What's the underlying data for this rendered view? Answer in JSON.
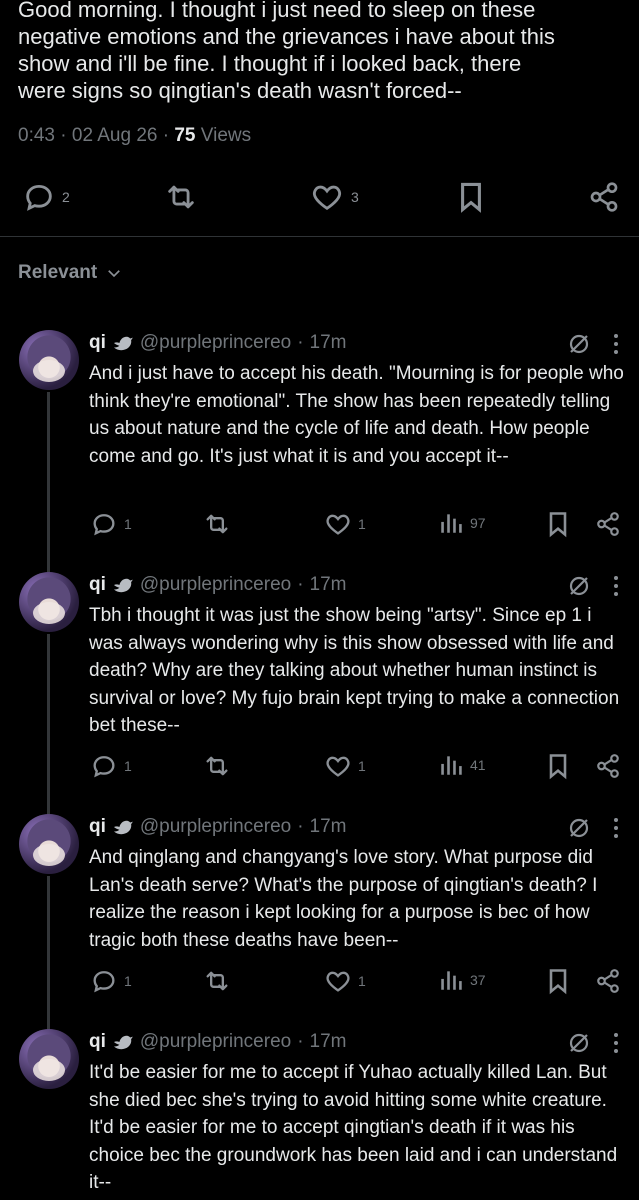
{
  "main_post": {
    "text": "Good morning. I thought i just need to sleep on these\nnegative emotions and the grievances i have about this\nshow and i'll be fine. I thought if i looked back, there\nwere signs so qingtian's death wasn't forced--",
    "time": "0:43",
    "date": "02 Aug 26",
    "views_count": "75",
    "views_label": "Views",
    "replies": "2",
    "likes": "3"
  },
  "sort": {
    "label": "Relevant"
  },
  "replies": [
    {
      "name": "qi",
      "handle": "@purpleprincereo",
      "time": "17m",
      "text": "And i just have to accept his death. \"Mourning is for people who think they're emotional\". The show has been repeatedly telling us about nature and the cycle of life and death. How people come and go. It's just what it is and you accept it--",
      "replies": "1",
      "likes": "1",
      "views": "97"
    },
    {
      "name": "qi",
      "handle": "@purpleprincereo",
      "time": "17m",
      "text": "Tbh i thought it was just the show being \"artsy\". Since ep 1 i was always wondering why is this show obsessed with life and death? Why are they talking about whether human instinct is survival or love? My fujo brain kept trying to make a connection bet these--",
      "replies": "1",
      "likes": "1",
      "views": "41"
    },
    {
      "name": "qi",
      "handle": "@purpleprincereo",
      "time": "17m",
      "text": "And qinglang and changyang's love story. What purpose did Lan's death serve? What's the purpose of qingtian's death? I realize the reason i kept looking for a purpose is bec of how tragic both these deaths have been--",
      "replies": "1",
      "likes": "1",
      "views": "37"
    },
    {
      "name": "qi",
      "handle": "@purpleprincereo",
      "time": "17m",
      "text": "It'd be easier for me to accept if Yuhao actually killed Lan. But she died bec she's trying to avoid hitting some white creature. It'd be easier for me to accept qingtian's death if it was his choice bec the groundwork has been laid and i can understand it--"
    }
  ],
  "icons": {
    "reply": "reply-icon",
    "repost": "repost-icon",
    "like": "like-icon",
    "bookmark": "bookmark-icon",
    "share": "share-icon",
    "views": "views-icon",
    "grok": "grok-icon",
    "more": "more-icon",
    "verified": "bird-badge-icon"
  },
  "colors": {
    "background": "#000000",
    "text": "#e7e9ea",
    "muted": "#71767b",
    "divider": "#2f3336"
  }
}
